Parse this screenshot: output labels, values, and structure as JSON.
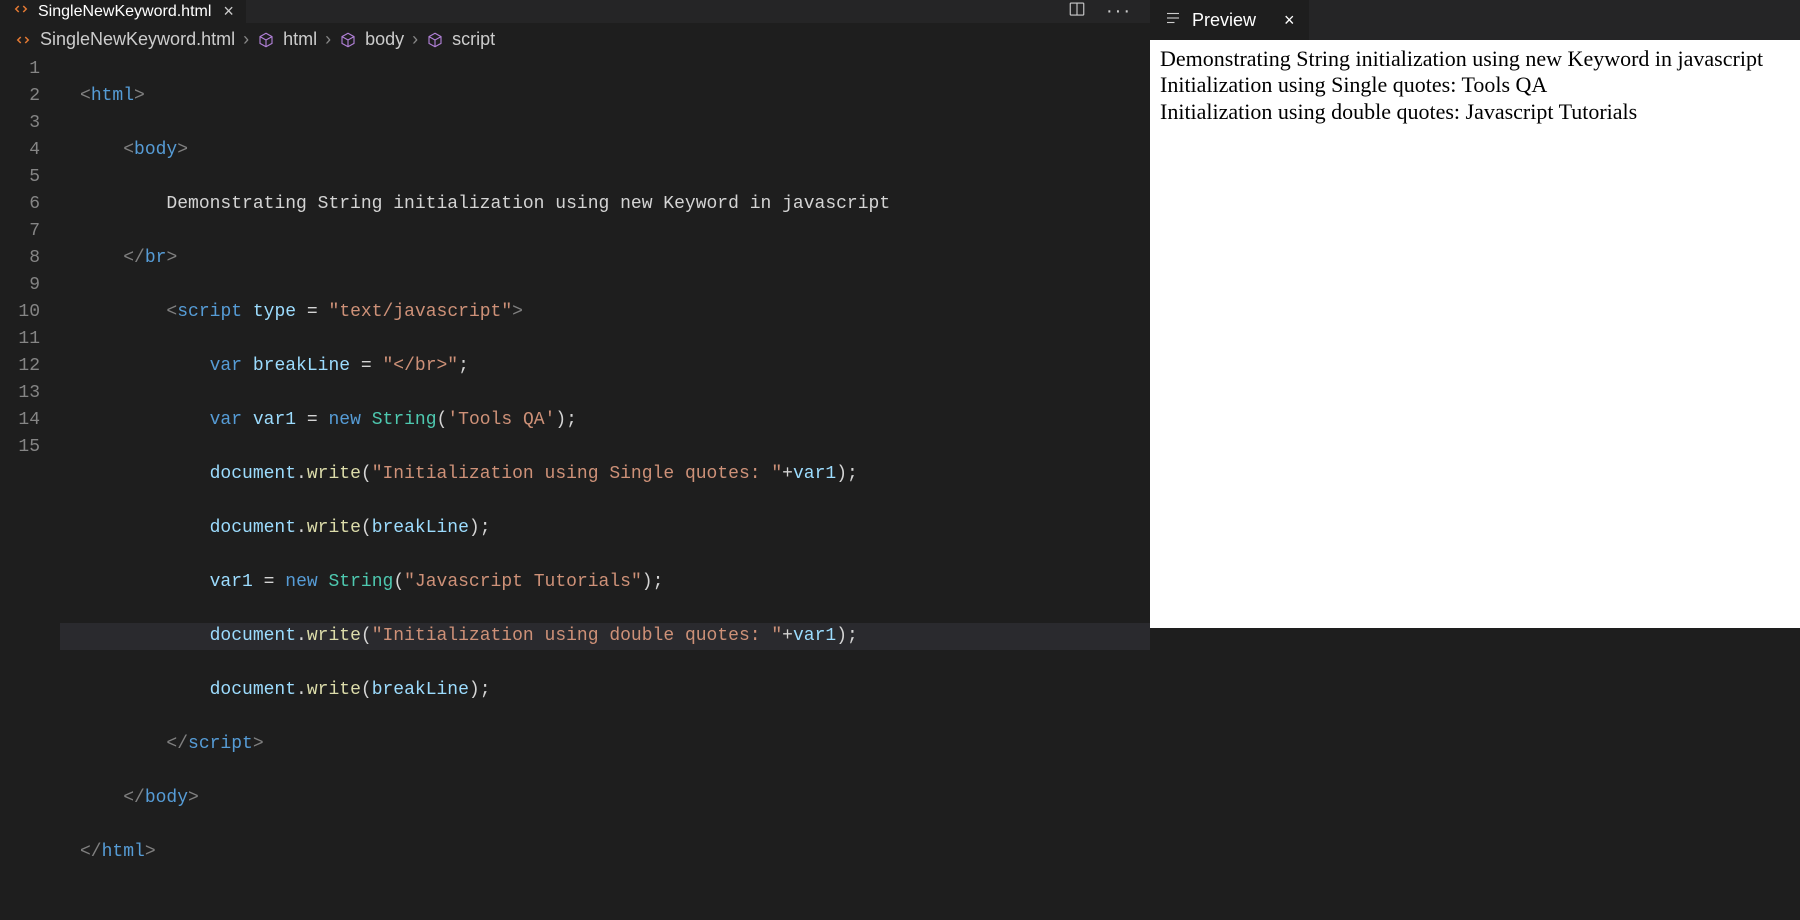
{
  "tab": {
    "filename": "SingleNewKeyword.html"
  },
  "breadcrumb": {
    "file": "SingleNewKeyword.html",
    "path1": "html",
    "path2": "body",
    "path3": "script"
  },
  "gutter": [
    "1",
    "2",
    "3",
    "4",
    "5",
    "6",
    "7",
    "8",
    "9",
    "10",
    "11",
    "12",
    "13",
    "14",
    "15"
  ],
  "code": {
    "l3_text": "Demonstrating String initialization using new Keyword in javascript",
    "l5_attr": "type",
    "l5_val": "\"text/javascript\"",
    "l6_var": "breakLine",
    "l6_val": "\"</br>\"",
    "l7_var": "var1",
    "l7_ctor": "String",
    "l7_arg": "'Tools QA'",
    "l8_obj": "document",
    "l8_fn": "write",
    "l8_str": "\"Initialization using Single quotes: \"",
    "l8_id": "var1",
    "l9_arg": "breakLine",
    "l10_var": "var1",
    "l10_ctor": "String",
    "l10_arg": "\"Javascript Tutorials\"",
    "l11_str": "\"Initialization using double quotes: \"",
    "l11_id": "var1",
    "l12_arg": "breakLine"
  },
  "preview": {
    "title": "Preview",
    "line1": "Demonstrating String initialization using new Keyword in javascript",
    "line2": "Initialization using Single quotes: Tools QA",
    "line3": "Initialization using double quotes: Javascript Tutorials"
  }
}
